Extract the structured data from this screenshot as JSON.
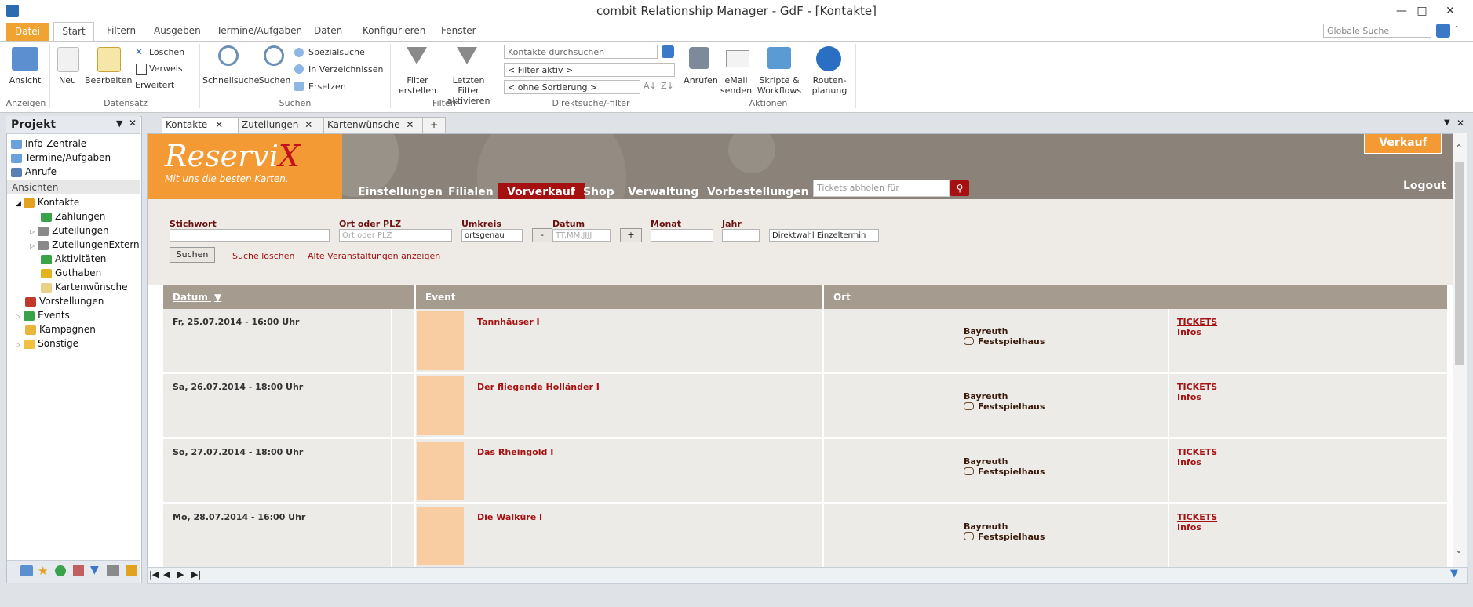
{
  "window": {
    "title": "combit Relationship Manager - GdF - [Kontakte]",
    "global_search_placeholder": "Globale Suche"
  },
  "ribbon_tabs": [
    "Datei",
    "Start",
    "Filtern",
    "Ausgeben",
    "Termine/Aufgaben",
    "Daten",
    "Konfigurieren",
    "Fenster"
  ],
  "ribbon": {
    "anzeigen": {
      "group": "Anzeigen",
      "ansicht": "Ansicht"
    },
    "datensatz": {
      "group": "Datensatz",
      "neu": "Neu",
      "bearbeiten": "Bearbeiten",
      "loeschen": "Löschen",
      "verweis": "Verweis",
      "erweitert": "Erweitert"
    },
    "suchen": {
      "group": "Suchen",
      "schnellsuche": "Schnellsuche",
      "suchen": "Suchen",
      "spezialsuche": "Spezialsuche",
      "in_verzeichnissen": "In Verzeichnissen",
      "ersetzen": "Ersetzen"
    },
    "filtern": {
      "group": "Filtern",
      "filter_erstellen_1": "Filter",
      "filter_erstellen_2": "erstellen",
      "letzten_filter_1": "Letzten Filter",
      "letzten_filter_2": "aktivieren"
    },
    "direktsuche": {
      "group": "Direktsuche/-filter",
      "search_placeholder": "Kontakte durchsuchen",
      "filter_value": "< Filter aktiv >",
      "sort_value": "< ohne Sortierung >"
    },
    "aktionen": {
      "group": "Aktionen",
      "anrufen": "Anrufen",
      "email_1": "eMail",
      "email_2": "senden",
      "skripte_1": "Skripte &",
      "skripte_2": "Workflows",
      "route_1": "Routen-",
      "route_2": "planung"
    }
  },
  "project_pane": {
    "title": "Projekt",
    "top_items": [
      "Info-Zentrale",
      "Termine/Aufgaben",
      "Anrufe"
    ],
    "section": "Ansichten",
    "kontakte": "Kontakte",
    "kontakte_children": [
      "Zahlungen",
      "Zuteilungen",
      "ZuteilungenExtern",
      "Aktivitäten",
      "Guthaben",
      "Kartenwünsche"
    ],
    "other_items": [
      "Vorstellungen",
      "Events",
      "Kampagnen",
      "Sonstige"
    ]
  },
  "doc_tabs": [
    "Kontakte",
    "Zuteilungen",
    "Kartenwünsche"
  ],
  "site": {
    "logo_main": "Reservi",
    "logo_x": "X",
    "logo_tagline": "Mit uns die besten Karten.",
    "nav": [
      "Einstellungen",
      "Filialen",
      "Vorverkauf",
      "Shop",
      "Verwaltung",
      "Vorbestellungen"
    ],
    "ticket_search_placeholder": "Tickets abholen für",
    "verkauf": "Verkauf",
    "logout": "Logout"
  },
  "filters": {
    "stichwort_label": "Stichwort",
    "ort_label": "Ort oder PLZ",
    "ort_placeholder": "Ort oder PLZ",
    "umkreis_label": "Umkreis",
    "umkreis_value": "ortsgenau",
    "datum_label": "Datum",
    "datum_minus": "-",
    "datum_placeholder": "TT.MM.JJJJ",
    "datum_plus": "+",
    "monat_label": "Monat",
    "jahr_label": "Jahr",
    "direktwahl": "Direktwahl Einzeltermin",
    "suchen_button": "Suchen",
    "suche_loeschen": "Suche löschen",
    "alte_veranstaltungen": "Alte Veranstaltungen anzeigen"
  },
  "table": {
    "headers": {
      "datum": "Datum",
      "event": "Event",
      "ort": "Ort"
    },
    "rows": [
      {
        "date": "Fr, 25.07.2014 - 16:00 Uhr",
        "event": "Tannhäuser I",
        "city": "Bayreuth",
        "venue": "Festspielhaus",
        "tickets": "TICKETS",
        "infos": "Infos"
      },
      {
        "date": "Sa, 26.07.2014 - 18:00 Uhr",
        "event": "Der fliegende Holländer I",
        "city": "Bayreuth",
        "venue": "Festspielhaus",
        "tickets": "TICKETS",
        "infos": "Infos"
      },
      {
        "date": "So, 27.07.2014 - 18:00 Uhr",
        "event": "Das Rheingold I",
        "city": "Bayreuth",
        "venue": "Festspielhaus",
        "tickets": "TICKETS",
        "infos": "Infos"
      },
      {
        "date": "Mo, 28.07.2014 - 16:00 Uhr",
        "event": "Die Walküre I",
        "city": "Bayreuth",
        "venue": "Festspielhaus",
        "tickets": "TICKETS",
        "infos": "Infos"
      }
    ]
  },
  "colors": {
    "accent_orange": "#f39a35",
    "brand_red": "#a61010",
    "header_brown": "#8b8379",
    "table_header": "#a59c8f"
  }
}
